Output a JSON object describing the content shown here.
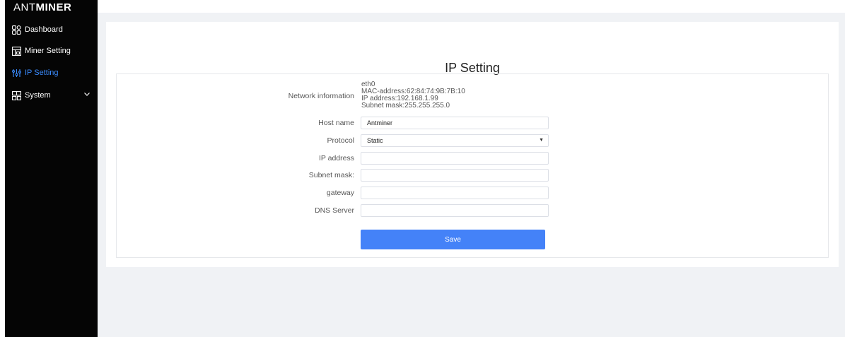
{
  "brand": {
    "light": "ANT",
    "bold": "MINER"
  },
  "sidebar": {
    "items": [
      {
        "label": "Dashboard",
        "icon": "dashboard-icon"
      },
      {
        "label": "Miner Setting",
        "icon": "miner-setting-icon"
      },
      {
        "label": "IP Setting",
        "icon": "ip-setting-icon",
        "active": true
      },
      {
        "label": "System",
        "icon": "system-icon",
        "expandable": true
      }
    ]
  },
  "page": {
    "title": "IP Setting"
  },
  "network_info": {
    "label": "Network information",
    "interface": "eth0",
    "mac": "MAC-address:62:84:74:9B:7B:10",
    "ip": "IP address:192.168.1.99",
    "subnet": "Subnet mask:255.255.255.0"
  },
  "form": {
    "host_name": {
      "label": "Host name",
      "value": "Antminer"
    },
    "protocol": {
      "label": "Protocol",
      "value": "Static"
    },
    "ip_address": {
      "label": "IP address",
      "value": ""
    },
    "subnet_mask": {
      "label": "Subnet mask:",
      "value": ""
    },
    "gateway": {
      "label": "gateway",
      "value": ""
    },
    "dns_server": {
      "label": "DNS Server",
      "value": ""
    },
    "save_label": "Save"
  },
  "colors": {
    "accent": "#4482f8",
    "active_nav": "#3b8cff",
    "sidebar": "#050505",
    "background": "#f0f2f5"
  }
}
